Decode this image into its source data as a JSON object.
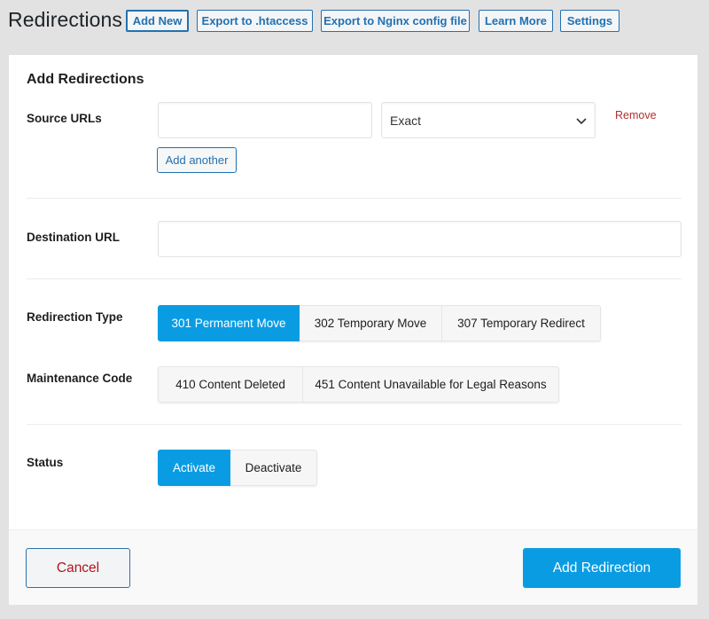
{
  "header": {
    "title": "Redirections",
    "buttons": [
      {
        "label": "Add New"
      },
      {
        "label": "Export to .htaccess"
      },
      {
        "label": "Export to Nginx config file"
      },
      {
        "label": "Learn More"
      },
      {
        "label": "Settings"
      }
    ]
  },
  "form": {
    "title": "Add Redirections",
    "source": {
      "label": "Source URLs",
      "url_value": "",
      "match_type": "Exact",
      "remove_label": "Remove",
      "add_another_label": "Add another"
    },
    "destination": {
      "label": "Destination URL",
      "value": ""
    },
    "redirection_type": {
      "label": "Redirection Type",
      "options": [
        "301 Permanent Move",
        "302 Temporary Move",
        "307 Temporary Redirect"
      ],
      "selected": "301 Permanent Move"
    },
    "maintenance_code": {
      "label": "Maintenance Code",
      "options": [
        "410 Content Deleted",
        "451 Content Unavailable for Legal Reasons"
      ],
      "selected": null
    },
    "status": {
      "label": "Status",
      "options": [
        "Activate",
        "Deactivate"
      ],
      "selected": "Activate"
    }
  },
  "footer": {
    "cancel_label": "Cancel",
    "submit_label": "Add Redirection"
  },
  "colors": {
    "accent": "#0a9ce3",
    "link": "#2271b1",
    "danger": "#b32d2e"
  }
}
